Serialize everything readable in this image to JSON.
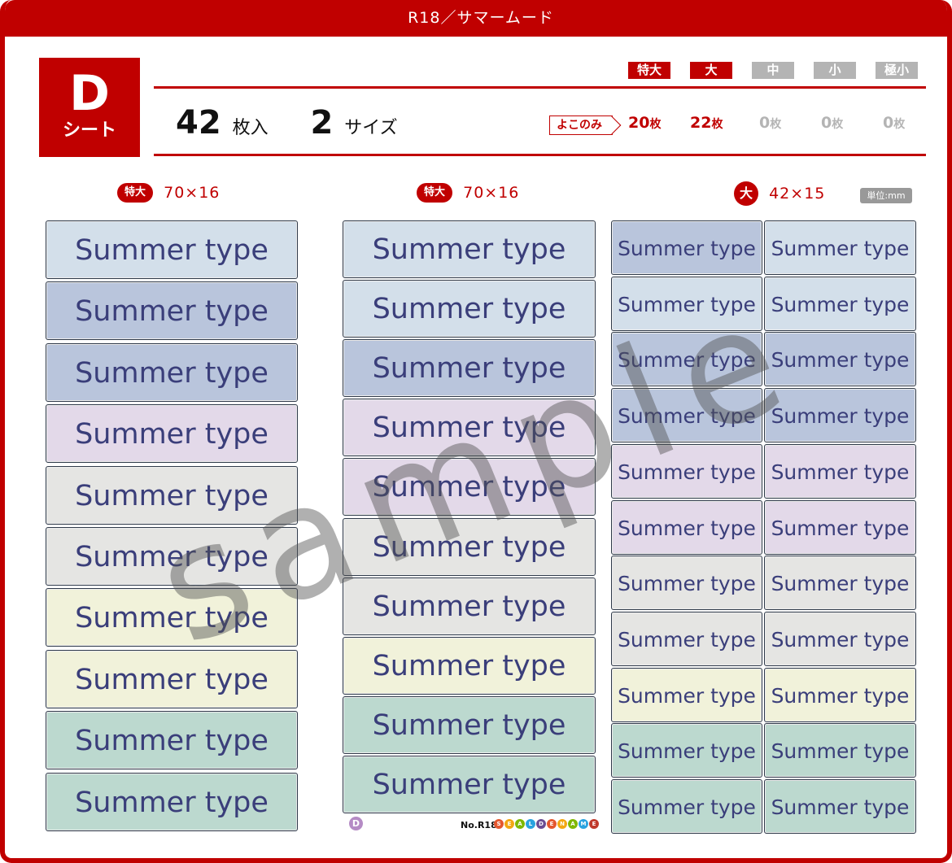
{
  "title": "R18／サマームード",
  "sheet": {
    "letter": "D",
    "label": "シート"
  },
  "count": {
    "sheets": "42",
    "sheets_unit": "枚入",
    "sizes": "2",
    "sizes_unit": "サイズ"
  },
  "size_badges": [
    {
      "label": "特大",
      "active": true
    },
    {
      "label": "大",
      "active": true
    },
    {
      "label": "中",
      "active": false
    },
    {
      "label": "小",
      "active": false
    },
    {
      "label": "極小",
      "active": false
    }
  ],
  "yoko_label": "よこのみ",
  "quantities": [
    {
      "num": "20",
      "unit": "枚",
      "active": true
    },
    {
      "num": "22",
      "unit": "枚",
      "active": true
    },
    {
      "num": "0",
      "unit": "枚",
      "active": false
    },
    {
      "num": "0",
      "unit": "枚",
      "active": false
    },
    {
      "num": "0",
      "unit": "枚",
      "active": false
    }
  ],
  "columns": [
    {
      "badge": "特大",
      "dims": "70×16"
    },
    {
      "badge": "特大",
      "dims": "70×16"
    },
    {
      "badge": "大",
      "dims": "42×15"
    }
  ],
  "unit_note": "単位:mm",
  "label_text": "Summer type",
  "colors": {
    "red": "#c00000",
    "inactive": "#b4b4b4",
    "text": "#3a3e7a",
    "swatches": {
      "blue": "#d3dfea",
      "navy": "#b9c5dc",
      "lavender": "#e3d9e9",
      "gray": "#e5e5e3",
      "cream": "#f1f2da",
      "mint": "#bcd9cf"
    }
  },
  "column_swatches": [
    [
      "blue",
      "navy",
      "navy",
      "lavender",
      "gray",
      "gray",
      "cream",
      "cream",
      "mint",
      "mint"
    ],
    [
      "blue",
      "blue",
      "navy",
      "lavender",
      "lavender",
      "gray",
      "gray",
      "cream",
      "mint",
      "mint"
    ],
    [
      "navy",
      "blue",
      "navy",
      "navy",
      "lavender",
      "lavender",
      "gray",
      "gray",
      "cream",
      "mint",
      "mint"
    ]
  ],
  "column3_right_swatches": [
    "blue",
    "blue",
    "navy",
    "navy",
    "lavender",
    "lavender",
    "gray",
    "gray",
    "cream",
    "mint",
    "mint"
  ],
  "watermark": "sample",
  "footer": {
    "sheet_letter": "D",
    "product_no": "No.R18",
    "brand_letters": [
      "S",
      "E",
      "A",
      "L",
      "D",
      "E",
      "N",
      "A",
      "M",
      "E"
    ]
  }
}
